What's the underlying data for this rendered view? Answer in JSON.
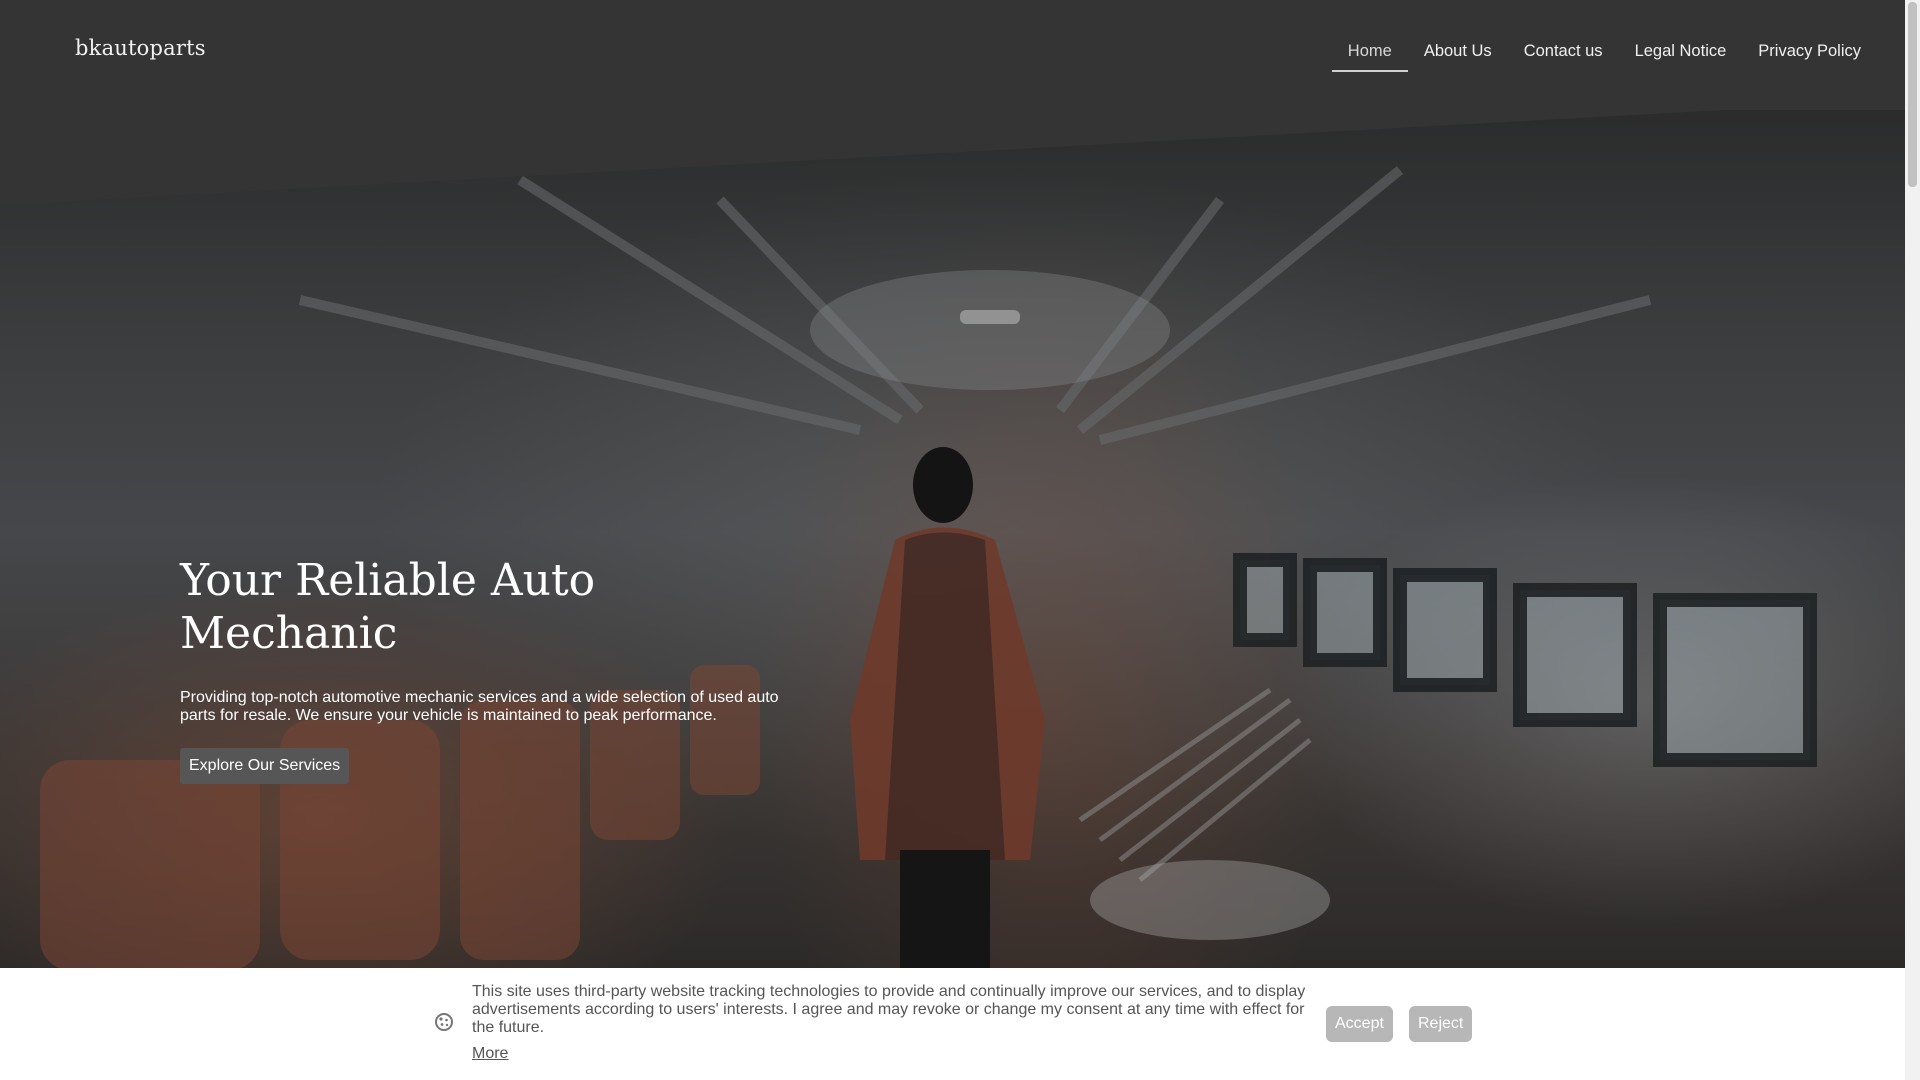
{
  "header": {
    "brand": "bkautoparts",
    "nav": [
      "Home",
      "About Us",
      "Contact us",
      "Legal Notice",
      "Privacy Policy"
    ],
    "active_item": "Home"
  },
  "hero": {
    "title": "Your Reliable Auto Mechanic",
    "description": "Providing top-notch automotive mechanic services and a wide selection of used auto parts for resale. We ensure your vehicle is maintained to peak performance.",
    "cta_label": "Explore Our Services"
  },
  "cookie_banner": {
    "icon": "cookie-icon",
    "text": "This site uses third-party website tracking technologies to provide and continually improve our services, and to display advertisements according to users' interests. I agree and may revoke or change my consent at any time with effect for the future.",
    "more_label": "More",
    "accept_label": "Accept",
    "reject_label": "Reject"
  },
  "colors": {
    "header_bg": "#343434",
    "cta_bg": "#565656",
    "cookie_button_bg": "#b7b7b7",
    "cookie_text": "#555555"
  }
}
